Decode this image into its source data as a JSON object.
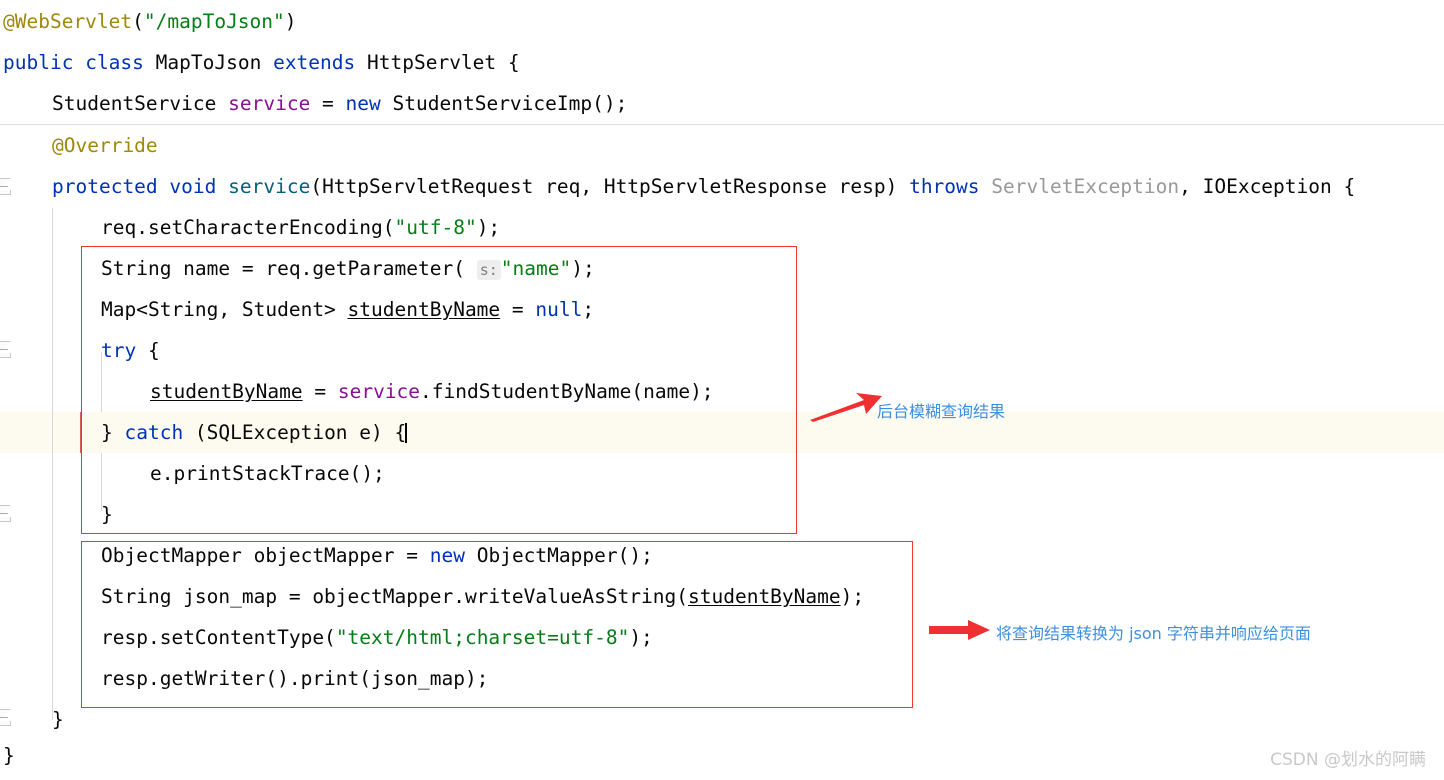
{
  "editor": {
    "language": "java",
    "background_color": "#ffffff",
    "current_line_highlight_color": "#fdfbf0",
    "caret_line_marker_color": "#e05a5a",
    "lines": [
      {
        "id": "line-webservlet",
        "text": "@WebServlet(\"/mapToJson\")"
      },
      {
        "id": "line-class-decl",
        "text": "public class MapToJson extends HttpServlet {"
      },
      {
        "id": "line-field-service",
        "text": "StudentService service = new StudentServiceImp();"
      },
      {
        "id": "line-override",
        "text": "@Override"
      },
      {
        "id": "line-service-sig",
        "text": "protected void service(HttpServletRequest req, HttpServletResponse resp) throws ServletException, IOException {"
      },
      {
        "id": "line-encoding",
        "text": "req.setCharacterEncoding(\"utf-8\");"
      },
      {
        "id": "line-get-name",
        "text": "String name = req.getParameter( s: \"name\");"
      },
      {
        "id": "line-map-decl",
        "text": "Map<String, Student> studentByName = null;"
      },
      {
        "id": "line-try",
        "text": "try {"
      },
      {
        "id": "line-find",
        "text": "studentByName = service.findStudentByName(name);"
      },
      {
        "id": "line-catch",
        "text": "} catch (SQLException e) {"
      },
      {
        "id": "line-printstack",
        "text": "e.printStackTrace();"
      },
      {
        "id": "line-close-catch",
        "text": "}"
      },
      {
        "id": "line-objectmapper",
        "text": "ObjectMapper objectMapper = new ObjectMapper();"
      },
      {
        "id": "line-json-map",
        "text": "String json_map = objectMapper.writeValueAsString(studentByName);"
      },
      {
        "id": "line-contenttype",
        "text": "resp.setContentType(\"text/html;charset=utf-8\");"
      },
      {
        "id": "line-print",
        "text": "resp.getWriter().print(json_map);"
      },
      {
        "id": "line-close-method",
        "text": "}"
      },
      {
        "id": "line-close-class",
        "text": "}"
      }
    ],
    "tokens": {
      "annotation_webservlet": "@WebServlet",
      "annotation_override": "@Override",
      "kw_public": "public",
      "kw_class": "class",
      "kw_extends": "extends",
      "kw_new": "new",
      "kw_protected": "protected",
      "kw_void": "void",
      "kw_throws": "throws",
      "kw_try": "try",
      "kw_catch": "catch",
      "kw_null": "null",
      "type_maptojson": "MapToJson",
      "type_httpservlet": "HttpServlet",
      "type_studentservice": "StudentService",
      "type_studentserviceimp": "StudentServiceImp",
      "type_servletexception": "ServletException",
      "type_ioexception": "IOException",
      "type_sqlexception": "SQLException",
      "type_objectmapper": "ObjectMapper",
      "field_service": "service",
      "var_studentbyname": "studentByName",
      "var_json_map": "json_map",
      "str_path": "\"/mapToJson\"",
      "str_utf8": "\"utf-8\"",
      "str_name": "\"name\"",
      "str_contenttype": "\"text/html;charset=utf-8\"",
      "inlay_hint_s": "s:"
    },
    "colors": {
      "keyword": "#0033b3",
      "annotation": "#9e880d",
      "string": "#067d17",
      "field": "#871094",
      "dimmed_type": "#999999",
      "plain": "#080808"
    }
  },
  "annotations": {
    "box_color": "#e8392c",
    "arrow_color": "#f03030",
    "text_color": "#3d8fe0",
    "items": [
      {
        "id": "annotation-query-result",
        "text": "后台模糊查询结果",
        "arrow": "red-arrow-up-right"
      },
      {
        "id": "annotation-json-response",
        "text": "将查询结果转换为 json 字符串并响应给页面",
        "arrow": "red-arrow-right"
      }
    ],
    "boxes": [
      {
        "id": "redbox-query-block"
      },
      {
        "id": "redbox-json-block"
      }
    ]
  },
  "watermark": {
    "text": "CSDN @划水的阿瞒"
  }
}
